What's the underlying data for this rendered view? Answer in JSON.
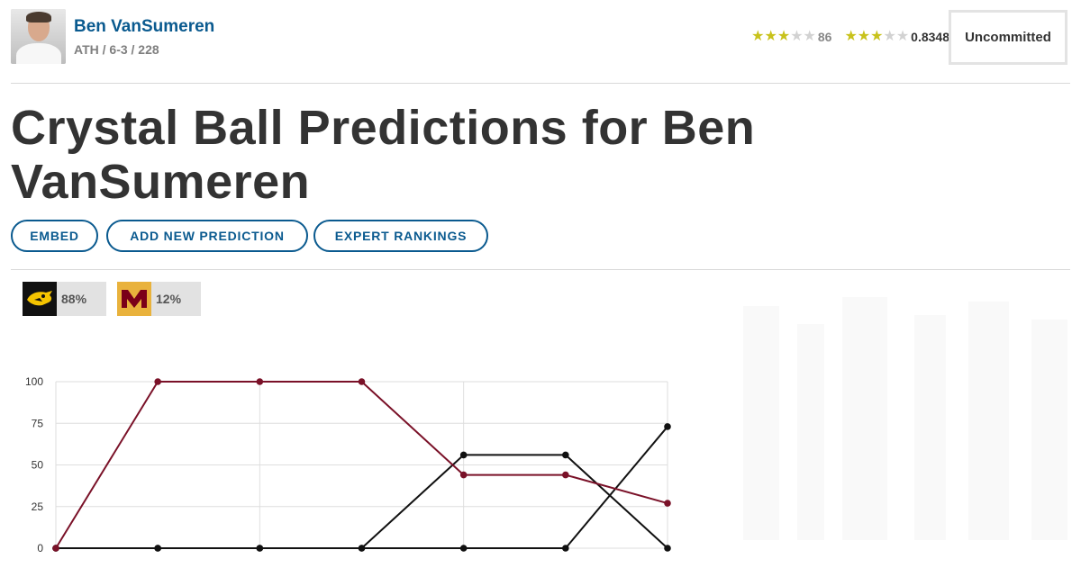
{
  "player": {
    "name": "Ben VanSumeren",
    "meta": "ATH / 6-3 / 228",
    "rating_stars_filled": 3,
    "rating_stars_total": 5,
    "rating": "86",
    "composite_stars_filled": 3,
    "composite_stars_total": 5,
    "composite": "0.8348",
    "status": "Uncommitted"
  },
  "page": {
    "title": "Crystal Ball Predictions for Ben VanSumeren"
  },
  "actions": {
    "embed": "EMBED",
    "add_prediction": "ADD NEW PREDICTION",
    "expert_rankings": "EXPERT RANKINGS"
  },
  "teams": [
    {
      "logo_icon": "iowa-hawkeye-icon",
      "logo_bg": "#111111",
      "logo_fg": "#f5c400",
      "pct": "88%"
    },
    {
      "logo_icon": "minnesota-m-icon",
      "logo_bg": "#e9b23c",
      "logo_fg": "#7a0019",
      "pct": "12%"
    }
  ],
  "chart_data": {
    "type": "line",
    "x": [
      1,
      2,
      3,
      4,
      5,
      6,
      7
    ],
    "ylim": [
      0,
      100
    ],
    "yticks": [
      "0",
      "25",
      "50",
      "75",
      "100"
    ],
    "grid": true,
    "series": [
      {
        "color": "#7a1128",
        "values": [
          0,
          100,
          100,
          100,
          44,
          44,
          27
        ]
      },
      {
        "color": "#111111",
        "values": [
          0,
          0,
          0,
          0,
          56,
          56,
          0
        ]
      },
      {
        "color": "#111111",
        "values": [
          0,
          0,
          0,
          0,
          0,
          0,
          73
        ]
      }
    ]
  }
}
